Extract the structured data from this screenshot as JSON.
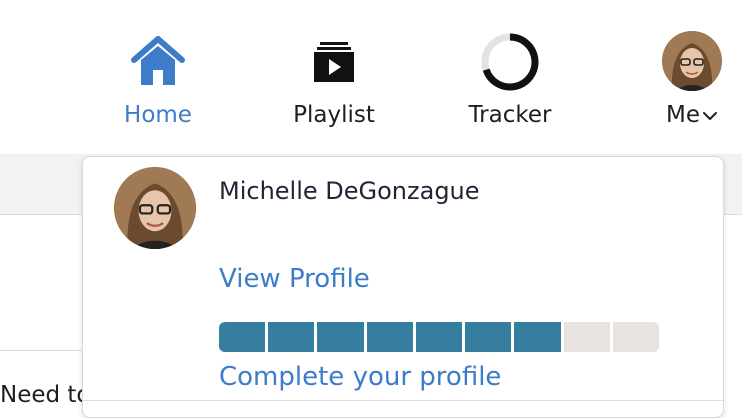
{
  "nav": {
    "items": [
      {
        "label": "Home",
        "icon": "home-icon",
        "active": true
      },
      {
        "label": "Playlist",
        "icon": "playlist-icon",
        "active": false
      },
      {
        "label": "Tracker",
        "icon": "tracker-icon",
        "active": false
      },
      {
        "label": "Me",
        "icon": "avatar",
        "active": false
      }
    ],
    "accent_color": "#3d7cc9"
  },
  "profile_menu": {
    "name": "Michelle DeGonzague",
    "view_profile_label": "View Profile",
    "complete_profile_label": "Complete your profile",
    "progress": {
      "completed_segments": 7,
      "total_segments": 9,
      "fill_color": "#357ea0",
      "empty_color": "#e6e3e1"
    }
  },
  "content": {
    "partial_text": "Need to"
  }
}
